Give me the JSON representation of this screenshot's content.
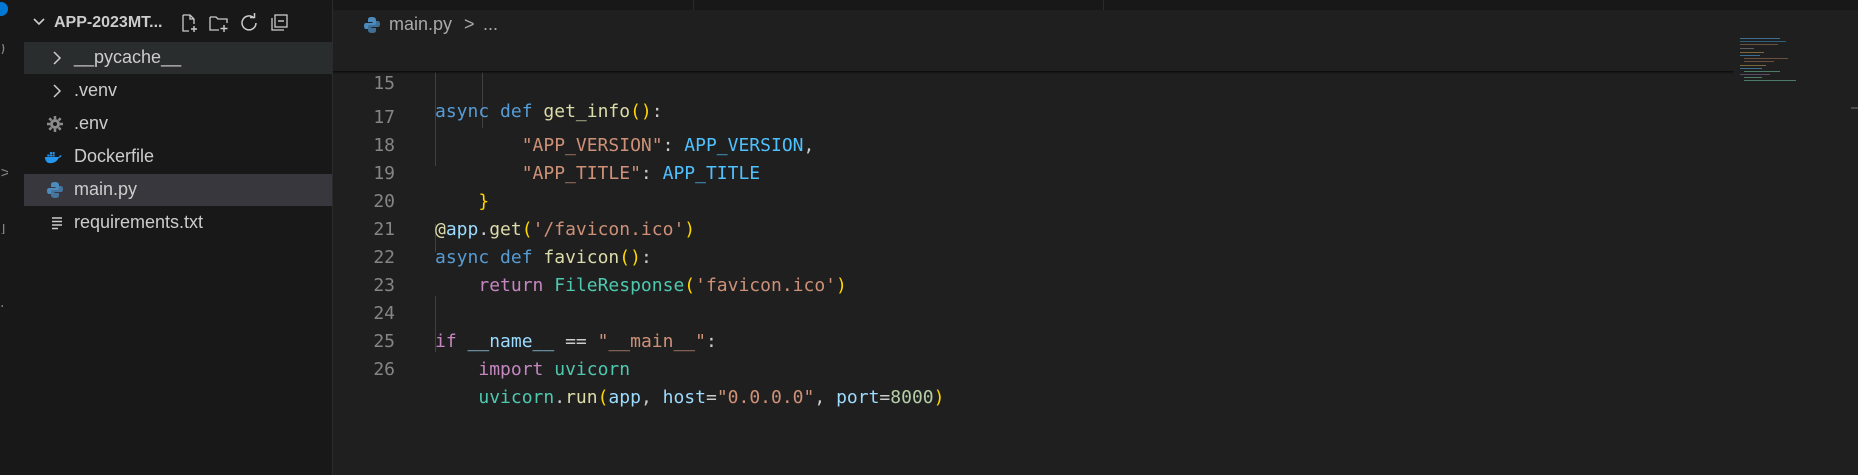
{
  "explorer": {
    "title": "APP-2023MT...",
    "actions": [
      "new-file",
      "new-folder",
      "refresh",
      "collapse-all"
    ],
    "items": [
      {
        "label": "__pycache__",
        "kind": "folder"
      },
      {
        "label": ".venv",
        "kind": "folder"
      },
      {
        "label": ".env",
        "kind": "env-file"
      },
      {
        "label": "Dockerfile",
        "kind": "docker-file"
      },
      {
        "label": "main.py",
        "kind": "python-file",
        "selected": true
      },
      {
        "label": "requirements.txt",
        "kind": "text-file"
      }
    ]
  },
  "breadcrumb": {
    "file": "main.py",
    "separator": ">",
    "more": "..."
  },
  "editor": {
    "sticky": {
      "number": "15",
      "code": "async def get_info():"
    },
    "lines": [
      {
        "number": "17",
        "code": "        \"APP_VERSION\": APP_VERSION,"
      },
      {
        "number": "18",
        "code": "        \"APP_TITLE\": APP_TITLE"
      },
      {
        "number": "19",
        "code": "    }"
      },
      {
        "number": "20",
        "code": "@app.get('/favicon.ico')"
      },
      {
        "number": "21",
        "code": "async def favicon():"
      },
      {
        "number": "22",
        "code": "    return FileResponse('favicon.ico')"
      },
      {
        "number": "23",
        "code": ""
      },
      {
        "number": "24",
        "code": "if __name__ == \"__main__\":"
      },
      {
        "number": "25",
        "code": "    import uvicorn"
      },
      {
        "number": "26",
        "code": "    uvicorn.run(app, host=\"0.0.0.0\", port=8000)"
      }
    ]
  },
  "theme": {
    "editor_bg": "#1f1f1f",
    "sidebar_bg": "#181818",
    "selection_bg": "#37373d",
    "keyword": "#569cd6",
    "control": "#c586c0",
    "function": "#dcdcaa",
    "string": "#ce9178",
    "variable": "#9cdcfe",
    "constant": "#4fc1ff",
    "class": "#4ec9b0",
    "number": "#b5cea8"
  }
}
